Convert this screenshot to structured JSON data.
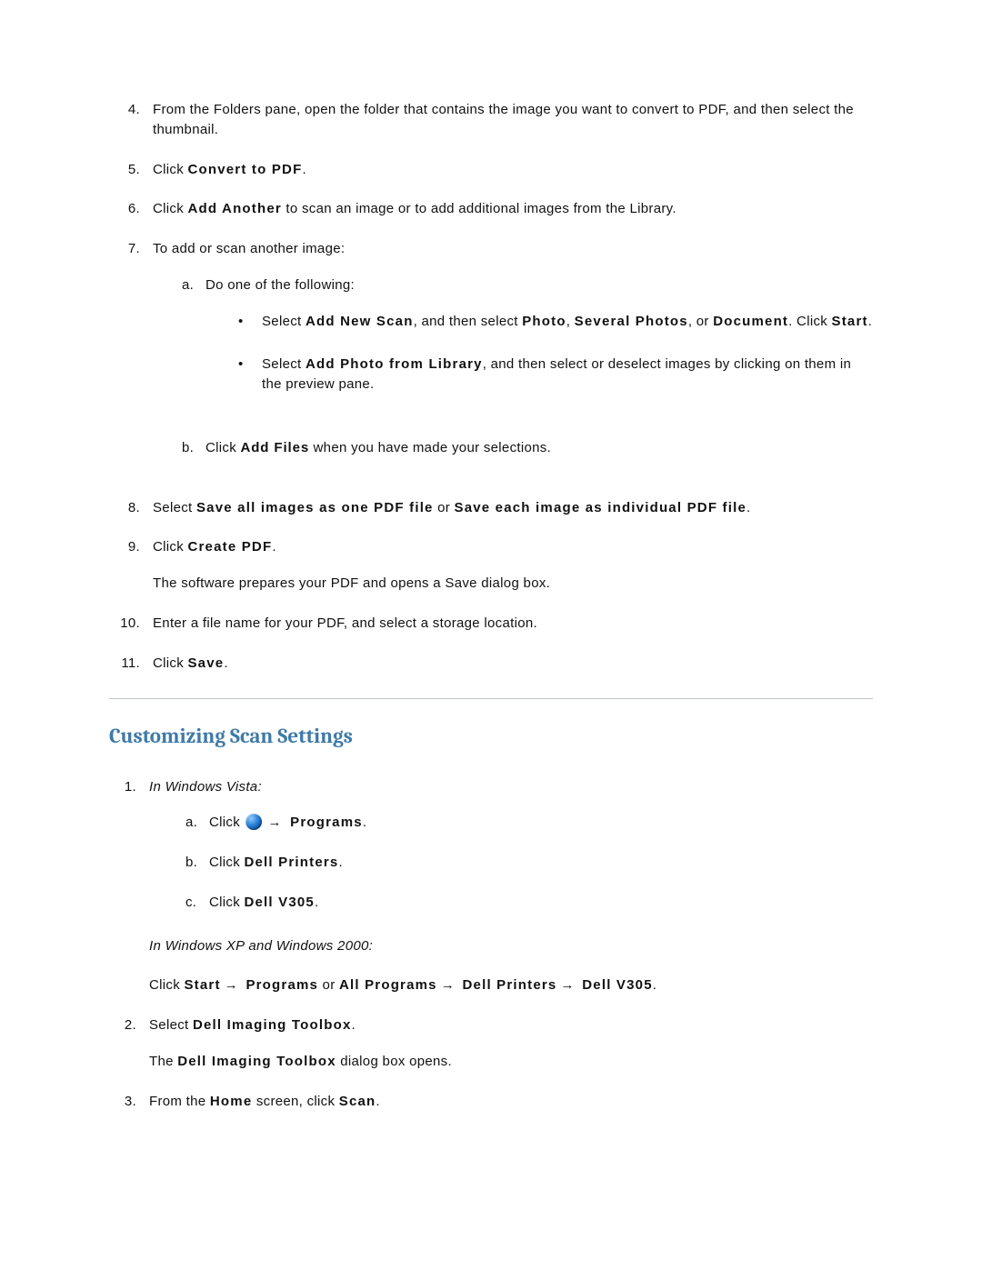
{
  "steps_top": {
    "4": {
      "text": "From the Folders pane, open the folder that contains the image you want to convert to PDF, and then select the thumbnail."
    },
    "5": {
      "pre": "Click ",
      "bold": "Convert to PDF",
      "post": "."
    },
    "6": {
      "pre": "Click ",
      "bold": "Add Another",
      "post": " to scan an image or to add additional images from the Library."
    },
    "7": {
      "text": "To add or scan another image:",
      "a": {
        "label": "a.",
        "text": "Do one of the following:",
        "b1": {
          "pre": "Select ",
          "b_a": "Add New Scan",
          "mid": ", and then select ",
          "b_b": "Photo",
          "mid2": ", ",
          "b_c": "Several Photos",
          "mid3": ", or ",
          "b_d": "Document",
          "mid4": ". Click ",
          "b_e": "Start",
          "post": "."
        },
        "b2": {
          "pre": "Select ",
          "b_a": "Add Photo from Library",
          "post": ", and then select or deselect images by clicking on them in the preview pane."
        }
      },
      "b": {
        "label": "b.",
        "pre": "Click ",
        "bold": "Add Files",
        "post": " when you have made your selections."
      }
    },
    "8": {
      "pre": "Select ",
      "b_a": "Save all images as one PDF file",
      "mid": " or ",
      "b_b": "Save each image as individual PDF file",
      "post": "."
    },
    "9": {
      "pre": "Click ",
      "bold": "Create PDF",
      "post": ".",
      "after": "The software prepares your PDF and opens a Save dialog box."
    },
    "10": {
      "text": "Enter a file name for your PDF, and select a storage location."
    },
    "11": {
      "pre": "Click ",
      "bold": "Save",
      "post": "."
    }
  },
  "section_heading": "Customizing Scan Settings",
  "sec2": {
    "1": {
      "italic": "In Windows Vista:",
      "a": {
        "label": "a.",
        "pre": "Click  ",
        "arrow": "→",
        "bold": " Programs",
        "post": "."
      },
      "b": {
        "label": "b.",
        "pre": "Click ",
        "bold": "Dell Printers",
        "post": "."
      },
      "c": {
        "label": "c.",
        "pre": "Click ",
        "bold": "Dell V305",
        "post": "."
      },
      "xp_label": "In Windows XP and Windows 2000:",
      "xp_line": {
        "pre": "Click ",
        "b_a": "Start",
        "a1": "→",
        "mid1": " ",
        "b_b": "Programs",
        "or": " or ",
        "b_c": "All Programs",
        "a2": "→",
        "mid2": " ",
        "b_d": "Dell Printers",
        "a3": "→",
        "mid3": " ",
        "b_e": "Dell V305",
        "post": "."
      }
    },
    "2": {
      "pre": "Select ",
      "bold": "Dell Imaging Toolbox",
      "post": ".",
      "after_pre": "The ",
      "after_bold": "Dell Imaging Toolbox",
      "after_post": " dialog box opens."
    },
    "3": {
      "pre": "From the ",
      "bold": "Home",
      "mid": " screen, click ",
      "bold2": "Scan",
      "post": "."
    }
  }
}
